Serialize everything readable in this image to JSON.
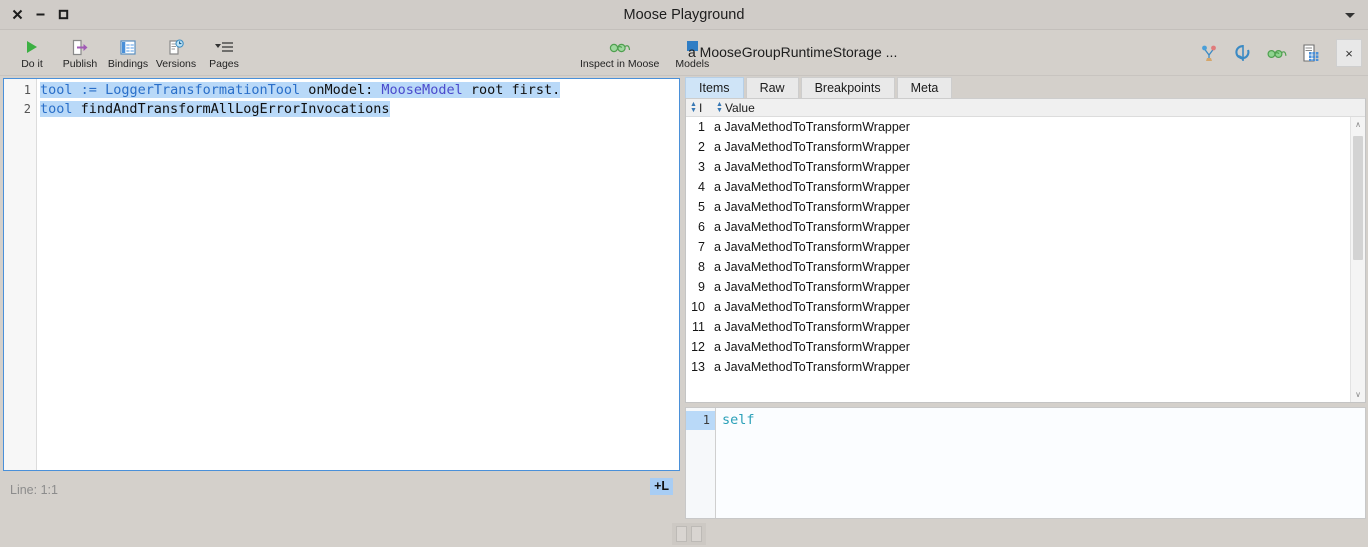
{
  "window": {
    "title": "Moose Playground",
    "controls": [
      {
        "name": "close",
        "glyph": "×"
      },
      {
        "name": "minimize",
        "glyph": "−"
      },
      {
        "name": "maximize",
        "glyph": "□"
      }
    ],
    "menu_icon": "chevron-down-icon"
  },
  "toolbar": {
    "left_buttons": [
      {
        "label": "Do it",
        "icon": "play-triangle-icon"
      },
      {
        "label": "Publish",
        "icon": "publish-arrow-icon"
      },
      {
        "label": "Bindings",
        "icon": "table-columns-icon"
      },
      {
        "label": "Versions",
        "icon": "document-clock-icon"
      },
      {
        "label": "Pages",
        "icon": "list-lines-icon"
      }
    ],
    "center_buttons": [
      {
        "label": "Inspect in Moose",
        "icon": "glasses-icon"
      },
      {
        "label": "Models",
        "icon": "blue-square-icon"
      }
    ],
    "context_label": "a MooseGroupRuntimeStorage ...",
    "right_icons": [
      {
        "name": "tree-graph-icon"
      },
      {
        "name": "refresh-cycle-icon"
      },
      {
        "name": "glasses-green-icon"
      },
      {
        "name": "spreadsheet-icon"
      }
    ],
    "close_label": "×"
  },
  "editor": {
    "lines": [
      {
        "number": "1",
        "tokens": [
          {
            "text": "tool",
            "style": "var"
          },
          {
            "text": " ",
            "style": "plain"
          },
          {
            "text": ":=",
            "style": "op"
          },
          {
            "text": " ",
            "style": "plain"
          },
          {
            "text": "LoggerTransformationTool",
            "style": "var"
          },
          {
            "text": " onModel: ",
            "style": "plain"
          },
          {
            "text": "MooseModel",
            "style": "class"
          },
          {
            "text": " root first.",
            "style": "plain"
          }
        ]
      },
      {
        "number": "2",
        "tokens": [
          {
            "text": "tool",
            "style": "var"
          },
          {
            "text": " findAndTransformAllLogErrorInvocations",
            "style": "plain"
          }
        ]
      }
    ],
    "status": "Line: 1:1",
    "add_line_label": "+L"
  },
  "inspector": {
    "tabs": [
      {
        "label": "Items",
        "active": true
      },
      {
        "label": "Raw",
        "active": false
      },
      {
        "label": "Breakpoints",
        "active": false
      },
      {
        "label": "Meta",
        "active": false
      }
    ],
    "columns": [
      "I",
      "Value"
    ],
    "rows": [
      {
        "index": "1",
        "value": "a JavaMethodToTransformWrapper"
      },
      {
        "index": "2",
        "value": "a JavaMethodToTransformWrapper"
      },
      {
        "index": "3",
        "value": "a JavaMethodToTransformWrapper"
      },
      {
        "index": "4",
        "value": "a JavaMethodToTransformWrapper"
      },
      {
        "index": "5",
        "value": "a JavaMethodToTransformWrapper"
      },
      {
        "index": "6",
        "value": "a JavaMethodToTransformWrapper"
      },
      {
        "index": "7",
        "value": "a JavaMethodToTransformWrapper"
      },
      {
        "index": "8",
        "value": "a JavaMethodToTransformWrapper"
      },
      {
        "index": "9",
        "value": "a JavaMethodToTransformWrapper"
      },
      {
        "index": "10",
        "value": "a JavaMethodToTransformWrapper"
      },
      {
        "index": "11",
        "value": "a JavaMethodToTransformWrapper"
      },
      {
        "index": "12",
        "value": "a JavaMethodToTransformWrapper"
      },
      {
        "index": "13",
        "value": "a JavaMethodToTransformWrapper"
      }
    ],
    "scroll_up_glyph": "∧",
    "scroll_down_glyph": "∨"
  },
  "mini_editor": {
    "line_number": "1",
    "text": "self"
  },
  "colors": {
    "accent_blue": "#4a90d9",
    "selection_blue": "#b9d9f8",
    "tab_active_blue": "#cfe4f7",
    "window_gray": "#d4d0cb",
    "keyword_blue": "#2a6fc9",
    "class_purple": "#4a4acc",
    "self_teal": "#2aa0b8"
  }
}
